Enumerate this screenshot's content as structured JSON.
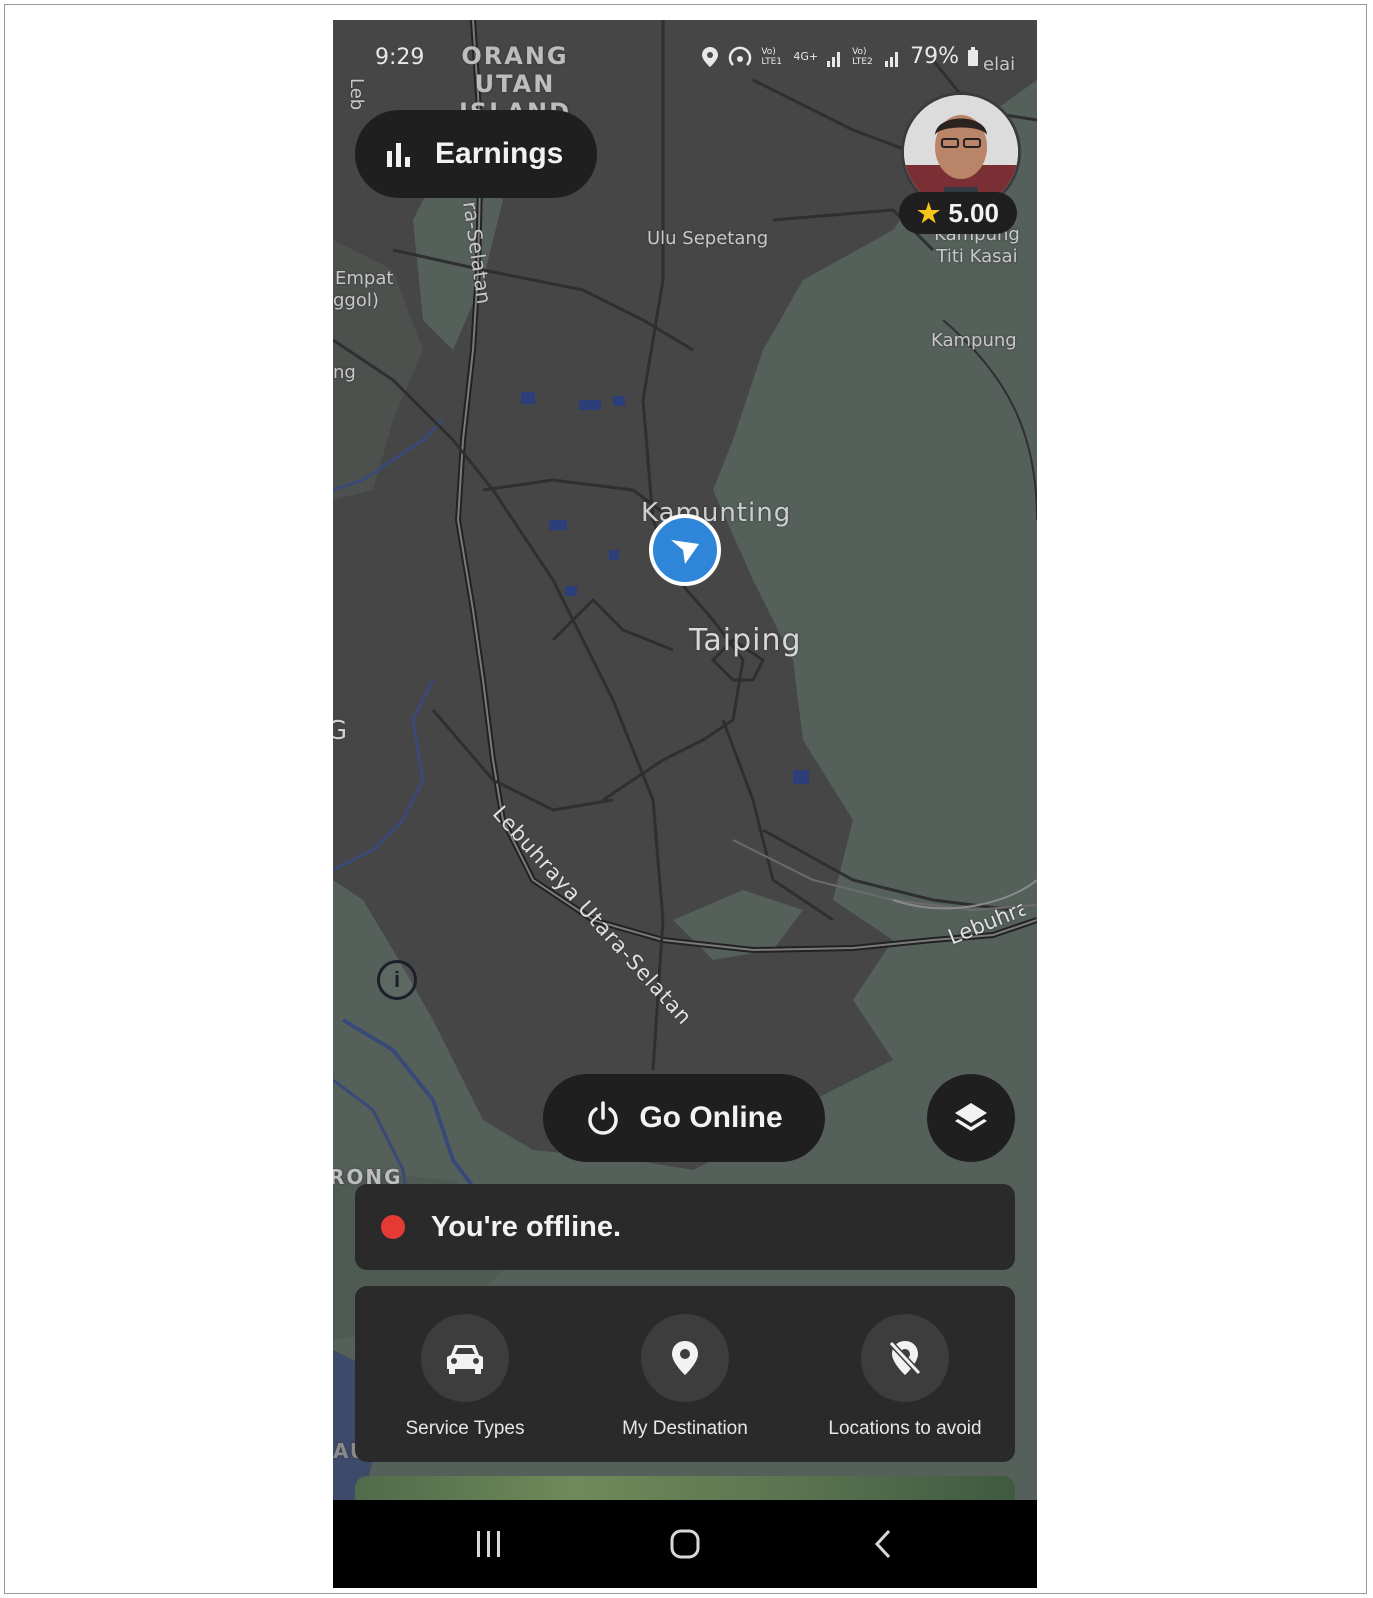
{
  "status_bar": {
    "time": "9:29",
    "battery": "79%",
    "network_labels": [
      "Vo) LTE1",
      "4G+",
      "Vo) LTE2"
    ]
  },
  "header": {
    "earnings_label": "Earnings",
    "rating": "5.00"
  },
  "map": {
    "labels": {
      "orang_utan_island": "ORANG UTAN ISLAND",
      "leb": "Leb",
      "ra_selatan": "ra-Selatan",
      "ulu_sepetang": "Ulu Sepetang",
      "kampung_titi_kasai": "Kampung Titi Kasai",
      "kampung": "Kampung",
      "empat": "Empat",
      "ggol": "ggol)",
      "ng": "ng",
      "kamunting": "Kamunting",
      "taiping": "Taiping",
      "g_edge": "G",
      "highway": "Lebuhraya Utara-Selatan",
      "lebuhr": "Lebuhra",
      "rong": "RONG",
      "au_sungai": "AU SUNGAI",
      "elai": "elai"
    }
  },
  "controls": {
    "go_online_label": "Go Online",
    "offline_text": "You're offline."
  },
  "actions": [
    {
      "label": "Service Types",
      "icon": "car-icon"
    },
    {
      "label": "My Destination",
      "icon": "pin-icon"
    },
    {
      "label": "Locations to avoid",
      "icon": "avoid-location-icon"
    }
  ],
  "colors": {
    "map_dark": "#454545",
    "map_green": "#55605a",
    "panel": "#2a2a2a",
    "button": "#1f1f1f",
    "marker_blue": "#2f86d9",
    "offline_red": "#e53935",
    "star": "#f5c518"
  }
}
